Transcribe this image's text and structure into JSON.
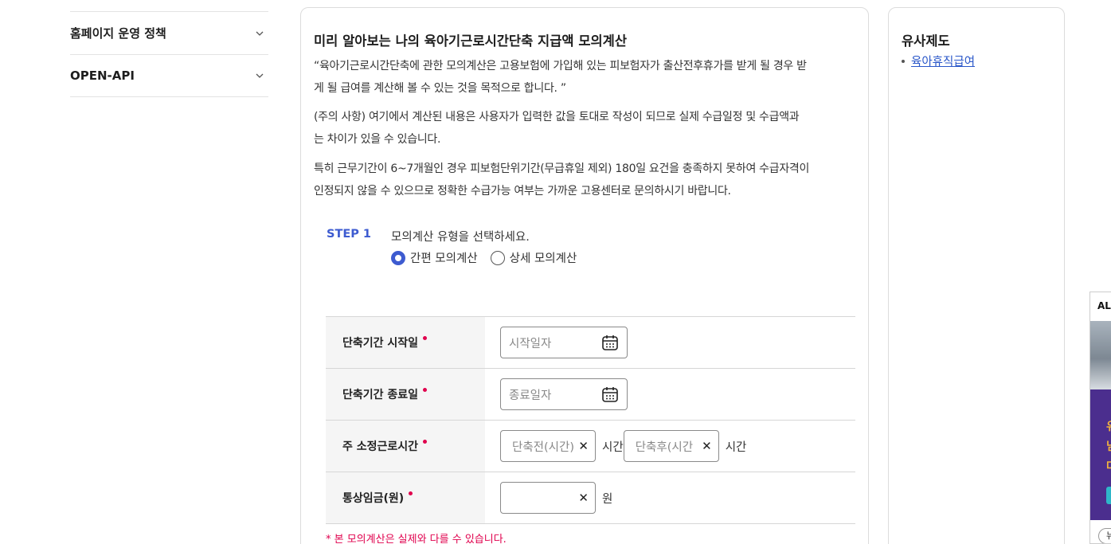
{
  "leftnav": {
    "items": [
      {
        "label": "홈페이지 운영 정책"
      },
      {
        "label": "OPEN-API"
      }
    ]
  },
  "main": {
    "title": "미리 알아보는 나의 육아기근로시간단축 지급액 모의계산",
    "para1_line1": "“육아기근로시간단축에 관한 모의계산은 고용보험에 가입해 있는 피보험자가 출산전후휴가를 받게 될 경우 받",
    "para1_line2": "게 될 급여를 계산해 볼 수 있는 것을 목적으로 합니다. ”",
    "para2_line1": "(주의 사항) 여기에서 계산된 내용은 사용자가 입력한 값을 토대로 작성이 되므로 실제 수급일정 및 수급액과",
    "para2_line2": "는 차이가 있을 수 있습니다.",
    "para3_line1": "특히 근무기간이 6~7개월인 경우 피보험단위기간(무급휴일 제외) 180일 요건을 충족하지 못하여 수급자격이",
    "para3_line2": "인정되지 않을 수 있으므로 정확한 수급가능 여부는 가까운 고용센터로 문의하시기 바랍니다.",
    "step": {
      "label": "STEP 1",
      "desc": "모의계산 유형을 선택하세요.",
      "options": [
        {
          "label": "간편 모의계산",
          "checked": true
        },
        {
          "label": "상세 모의계산",
          "checked": false
        }
      ]
    },
    "form": {
      "start": {
        "label": "단축기간 시작일",
        "placeholder": "시작일자"
      },
      "end": {
        "label": "단축기간 종료일",
        "placeholder": "종료일자"
      },
      "hours": {
        "label": "주 소정근로시간",
        "before_placeholder": "단축전(시간)",
        "after_placeholder": "단축후(시간",
        "unit": "시간"
      },
      "wage": {
        "label": "통상임금(원)",
        "value": "",
        "unit": "원"
      }
    },
    "notice": "* 본 모의계산은 실제와 다를 수 있습니다."
  },
  "side": {
    "title": "유사제도",
    "link": "육아휴직급여"
  },
  "ad": {
    "header": "AL",
    "chars": [
      "유",
      "넘",
      "다"
    ],
    "foot": "뉴"
  },
  "icons": {
    "chevron": "chevron-down-icon",
    "calendar": "calendar-icon",
    "clear": "close-icon"
  },
  "colors": {
    "accent": "#3d5bd0",
    "required": "#e0004d",
    "link": "#2a57c9"
  }
}
